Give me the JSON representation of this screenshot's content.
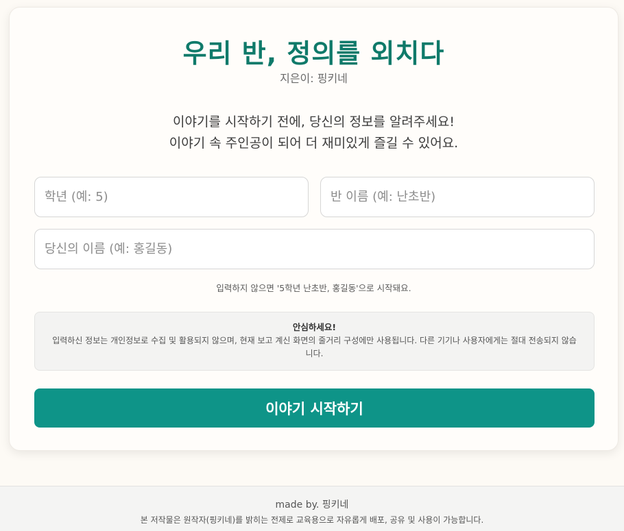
{
  "header": {
    "title": "우리 반, 정의를 외치다",
    "author": "지은이: 핑키네"
  },
  "intro": {
    "line1": "이야기를 시작하기 전에, 당신의 정보를 알려주세요!",
    "line2": "이야기 속 주인공이 되어 더 재미있게 즐길 수 있어요."
  },
  "form": {
    "grade_placeholder": "학년 (예: 5)",
    "class_placeholder": "반 이름 (예: 난초반)",
    "name_placeholder": "당신의 이름 (예: 홍길동)",
    "hint": "입력하지 않으면 '5학년 난초반, 홍길동'으로 시작돼요."
  },
  "notice": {
    "title": "안심하세요!",
    "body": "입력하신 정보는 개인정보로 수집 및 활용되지 않으며, 현재 보고 계신 화면의 줄거리 구성에만 사용됩니다. 다른 기기나 사용자에게는 절대 전송되지 않습니다."
  },
  "start_button": {
    "label": "이야기 시작하기"
  },
  "footer": {
    "made_by": "made by. 핑키네",
    "copyright": "본 저작물은 원작자(핑키네)를 밝히는 전제로 교육용으로 자유롭게 배포, 공유 및 사용이 가능합니다."
  },
  "colors": {
    "accent": "#0e9488",
    "title": "#0f7a6a",
    "background": "#fdfaf5"
  }
}
